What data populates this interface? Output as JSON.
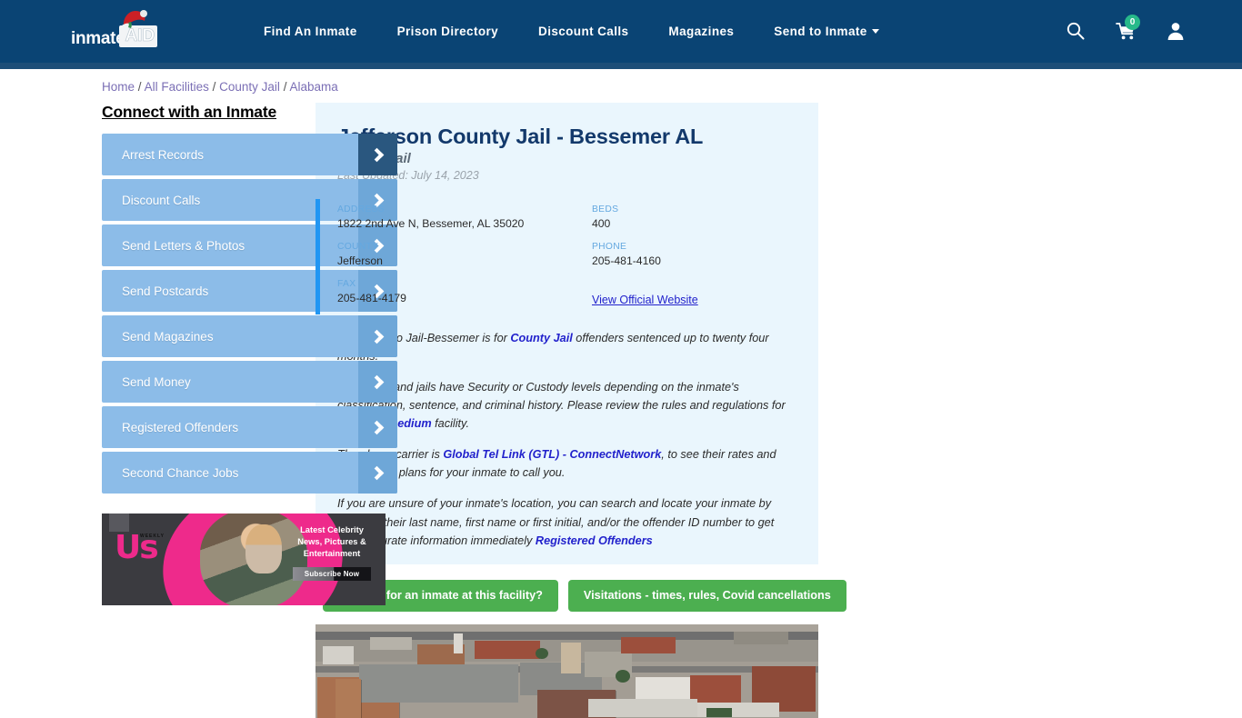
{
  "brand": {
    "logo_text": "inmate",
    "logo_accent": "AID",
    "santa_hat_icon": "santa-hat-icon",
    "header_color": "#0a4474"
  },
  "nav": {
    "items": [
      {
        "label": "Find An Inmate",
        "has_caret": false
      },
      {
        "label": "Prison Directory",
        "has_caret": false
      },
      {
        "label": "Discount Calls",
        "has_caret": false
      },
      {
        "label": "Magazines",
        "has_caret": false
      },
      {
        "label": "Send to Inmate",
        "has_caret": true
      }
    ],
    "search_icon": "search-icon",
    "cart_icon": "shopping-cart-icon",
    "cart_count": "0",
    "cart_badge_color": "#27b98a",
    "account_icon": "user-account-icon"
  },
  "breadcrumb": {
    "items": [
      "Home",
      "All Facilities",
      "County Jail",
      "Alabama"
    ],
    "separator": "/"
  },
  "sidebar": {
    "title": "Connect with an Inmate",
    "items": [
      {
        "label": "Arrest Records",
        "active": true
      },
      {
        "label": "Discount Calls",
        "active": false
      },
      {
        "label": "Send Letters & Photos",
        "active": false
      },
      {
        "label": "Send Postcards",
        "active": false
      },
      {
        "label": "Send Magazines",
        "active": false
      },
      {
        "label": "Send Money",
        "active": false
      },
      {
        "label": "Registered Offenders",
        "active": false
      },
      {
        "label": "Second Chance Jobs",
        "active": false
      }
    ]
  },
  "ad": {
    "brand": "Us",
    "brand_sub": "WEEKLY",
    "line1": "Latest Celebrity",
    "line2": "News, Pictures &",
    "line3": "Entertainment",
    "cta": "Subscribe Now"
  },
  "facility": {
    "title": "Jefferson County Jail - Bessemer AL",
    "type": "County Jail",
    "last_updated": "Last Updated: July 14, 2023",
    "fields": [
      {
        "label": "ADDRESS",
        "value": "1822 2nd Ave N, Bessemer, AL 35020"
      },
      {
        "label": "BEDS",
        "value": "400"
      },
      {
        "label": "COUNTY",
        "value": "Jefferson"
      },
      {
        "label": "PHONE",
        "value": "205-481-4160"
      },
      {
        "label": "FAX",
        "value": "205-481-4179"
      }
    ],
    "official_website_link": "View Official Website",
    "paragraphs": {
      "p1_a": "Jefferson Co Jail-Bessemer is for ",
      "p1_link": "County Jail",
      "p1_b": " offenders sentenced up to twenty four months.",
      "p2_a": "All prisons and jails have Security or Custody levels depending on the inmate's classification, sentence, and criminal history. Please review the rules and regulations for ",
      "p2_link": "County - medium",
      "p2_b": " facility.",
      "p3_a": "The phone carrier is ",
      "p3_link": "Global Tel Link (GTL) - ConnectNetwork",
      "p3_b": ", to see their rates and best-calling plans for your inmate to call you.",
      "p4_a": "If you are unsure of your inmate's location, you can search and locate your inmate by typing in their last name, first name or first initial, and/or the offender ID number to get their accurate information immediately ",
      "p4_link": "Registered Offenders"
    },
    "cta_buttons": [
      "Looking for an inmate at this facility?",
      "Visitations - times, rules, Covid cancellations"
    ],
    "photo_alt": "aerial-view-of-bessemer-alabama-downtown"
  },
  "colors": {
    "accent_blue": "#2196f3",
    "panel_bg": "#eaf6fd",
    "cta_green": "#4caf50",
    "sidebar_blue": "#8cbce8",
    "sidebar_arrow": "#6ea7d8",
    "sidebar_arrow_active": "#2a577f",
    "link_blue": "#2222cc",
    "breadcrumb_purple": "#7b6fb5"
  }
}
